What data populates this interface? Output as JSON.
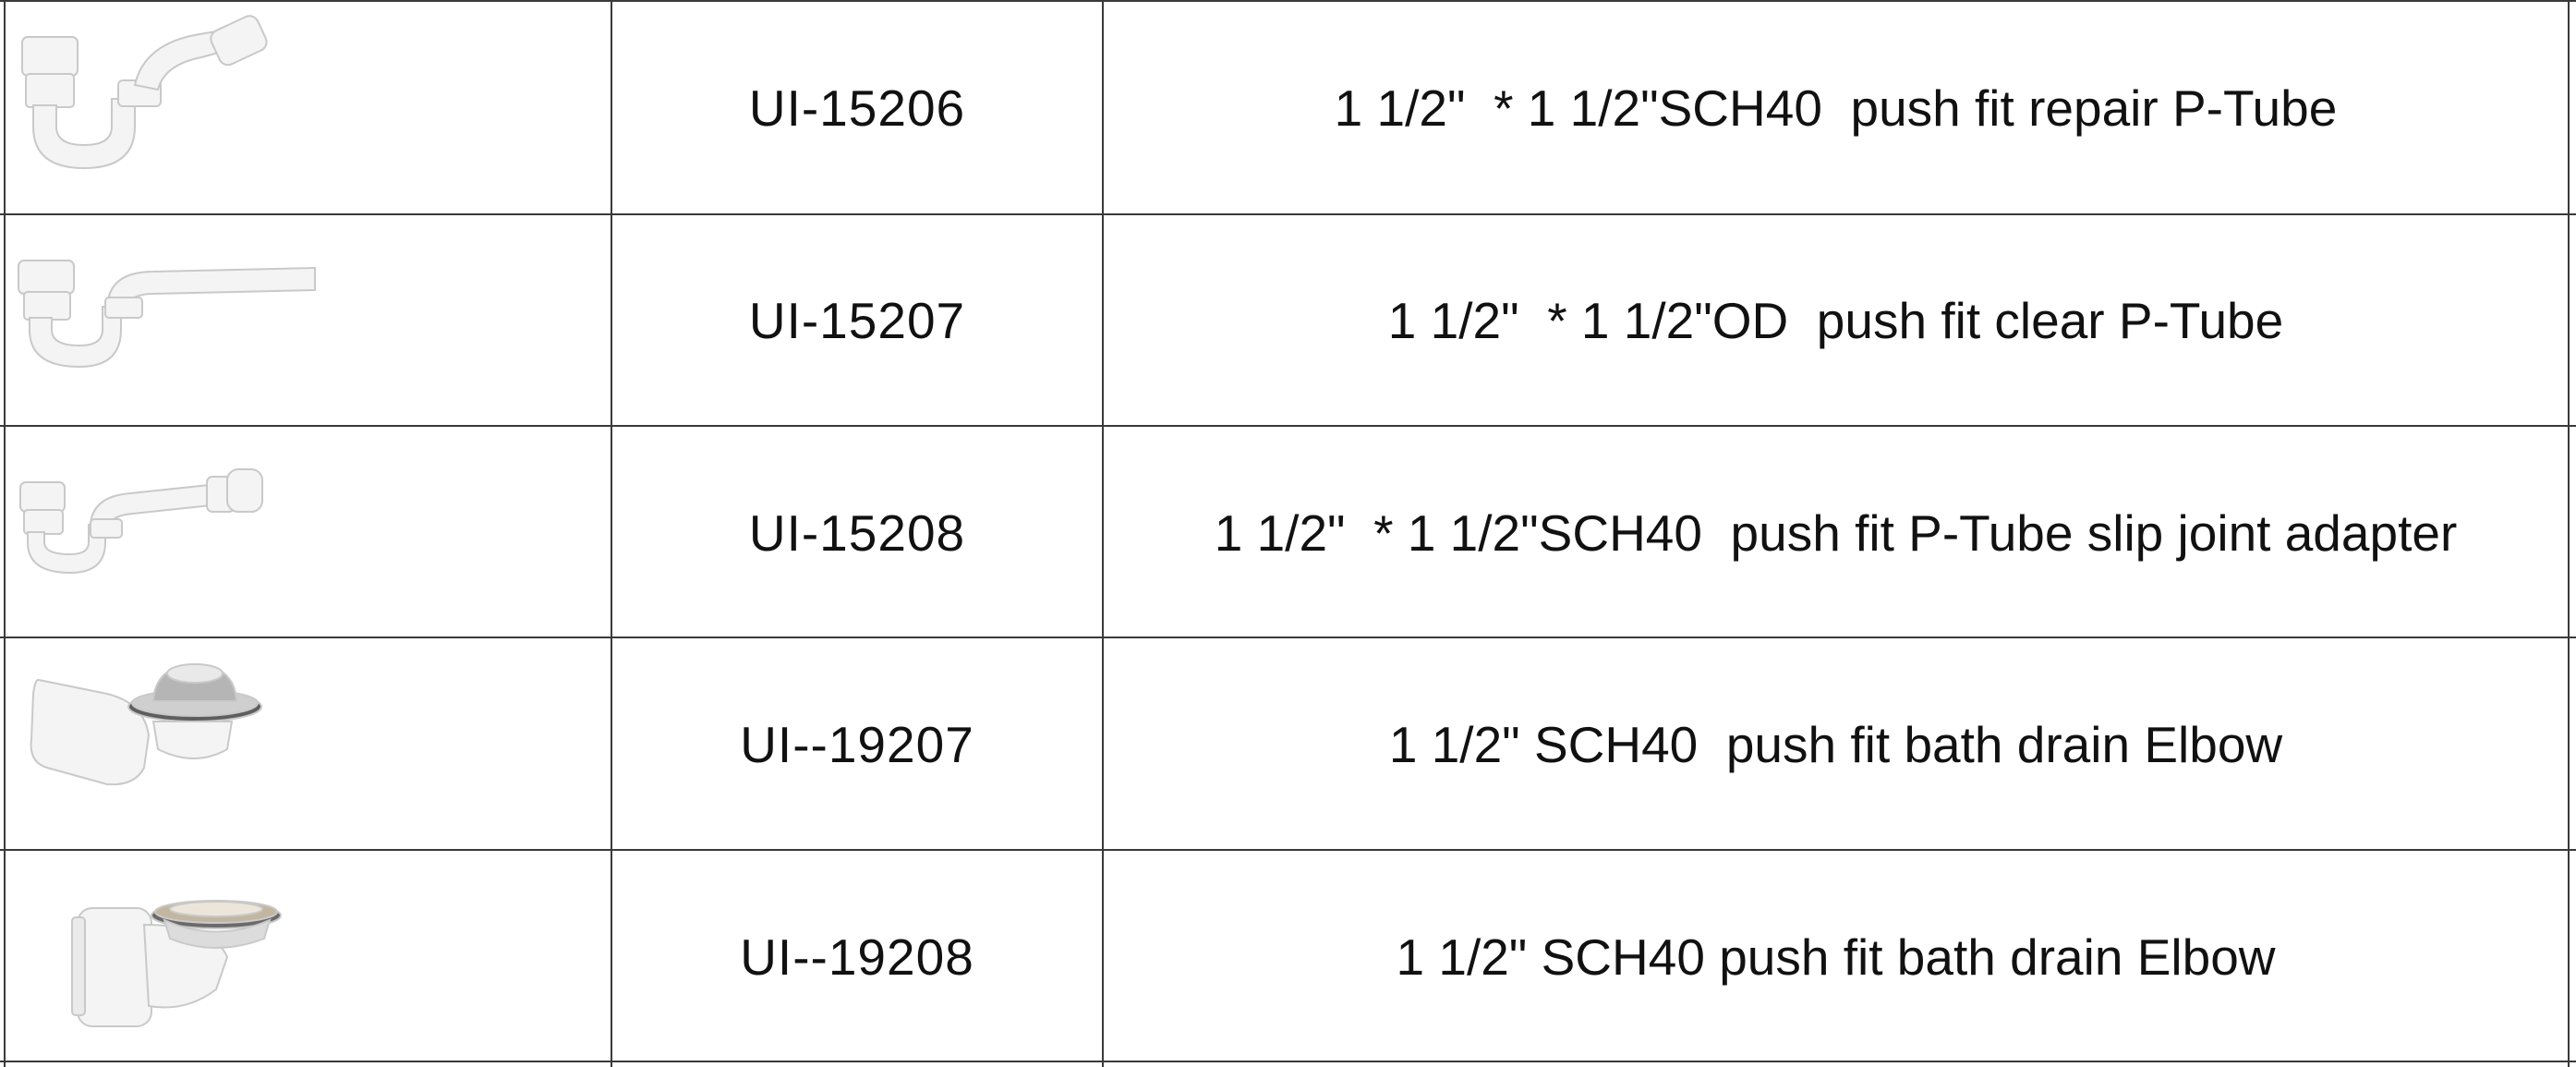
{
  "table": {
    "rows": [
      {
        "image": "p-tube-repair-image",
        "code": "UI-15206",
        "description": "1 1/2\"  * 1 1/2\"SCH40  push fit repair P-Tube"
      },
      {
        "image": "p-tube-clear-image",
        "code": "UI-15207",
        "description": "1 1/2\"  * 1 1/2\"OD  push fit clear P-Tube"
      },
      {
        "image": "p-tube-slip-joint-image",
        "code": "UI-15208",
        "description": "1 1/2\"  * 1 1/2\"SCH40  push fit P-Tube slip joint adapter"
      },
      {
        "image": "bath-drain-elbow-image",
        "code": "UI--19207",
        "description": "1 1/2\" SCH40  push fit bath drain Elbow"
      },
      {
        "image": "bath-drain-elbow-image",
        "code": "UI--19208",
        "description": "1 1/2\" SCH40 push fit bath drain Elbow"
      }
    ]
  },
  "colors": {
    "grid_line": "#3a3a3a",
    "text": "#111111",
    "fitting": "#f4f4f4",
    "chrome": "#a9a9a9"
  }
}
